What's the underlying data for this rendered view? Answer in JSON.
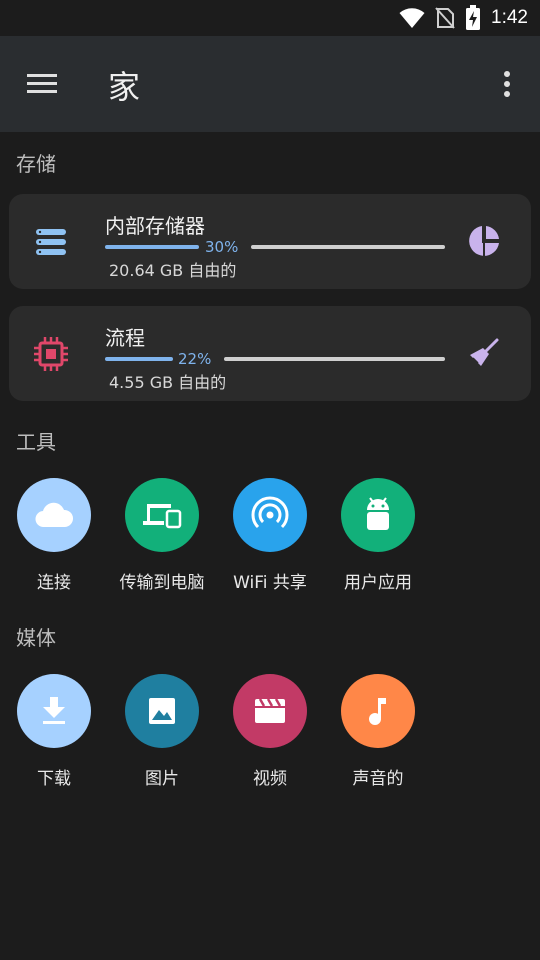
{
  "status_bar": {
    "time": "1:42",
    "icons": [
      "wifi-icon",
      "no-sim-icon",
      "battery-charging-icon"
    ]
  },
  "app_bar": {
    "title": "家",
    "icons": [
      "hamburger-menu-icon",
      "more-vert-icon"
    ]
  },
  "sections": {
    "storage": "存储",
    "tools": "工具",
    "media": "媒体"
  },
  "storage_items": [
    {
      "name": "内部存储器",
      "percent_label": "30%",
      "used_fraction": 0.3,
      "free_text": "20.64 GB 自由的",
      "lead_icon": "storage-stack-icon",
      "trail_icon": "pie-chart-icon"
    },
    {
      "name": "流程",
      "percent_label": "22%",
      "used_fraction": 0.22,
      "free_text": "4.55 GB 自由的",
      "lead_icon": "memory-chip-icon",
      "trail_icon": "broom-icon"
    }
  ],
  "tools": [
    {
      "label": "连接",
      "icon": "cloud-icon",
      "color": "#a6d1ff"
    },
    {
      "label": "传输到电脑",
      "icon": "devices-icon",
      "color": "#12b07a"
    },
    {
      "label": "WiFi 共享",
      "icon": "wifi-tethering-icon",
      "color": "#29a3ec"
    },
    {
      "label": "用户应用",
      "icon": "android-icon",
      "color": "#12b07a"
    }
  ],
  "media": [
    {
      "label": "下载",
      "icon": "download-icon",
      "color": "#a6d1ff"
    },
    {
      "label": "图片",
      "icon": "image-icon",
      "color": "#1f7fa0"
    },
    {
      "label": "视频",
      "icon": "movie-icon",
      "color": "#c23a66"
    },
    {
      "label": "声音的",
      "icon": "music-note-icon",
      "color": "#ff8748"
    }
  ],
  "colors": {
    "background": "#1c1c1c",
    "app_bar": "#2a2d30",
    "card": "#2b2b2b",
    "accent_blue": "#7fb3ec",
    "chip_red": "#e0476a",
    "lilac": "#c9b3ec"
  }
}
